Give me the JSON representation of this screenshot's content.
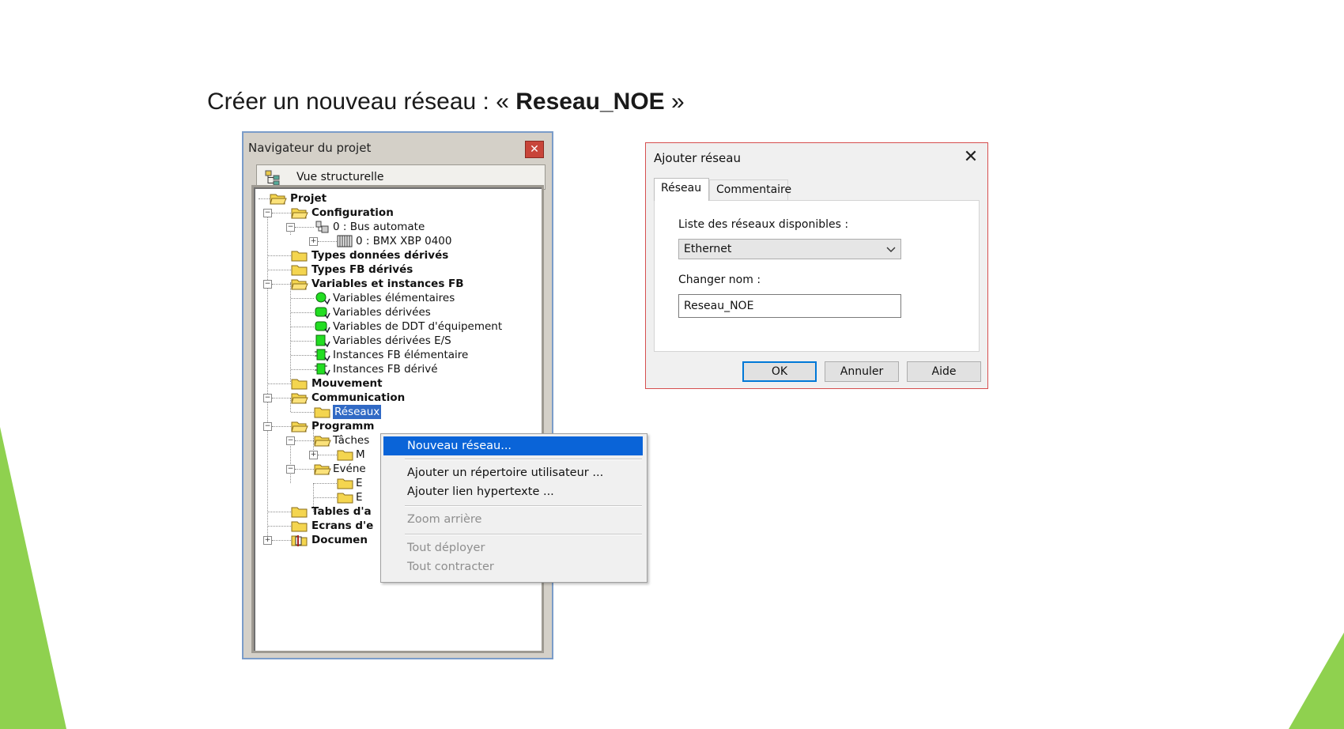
{
  "slide": {
    "title_prefix": "Créer un nouveau réseau : «",
    "title_bold": "Reseau_NOE",
    "title_suffix": "»"
  },
  "navigator": {
    "title": "Navigateur du projet",
    "close_icon": "close-icon",
    "view_label": "Vue structurelle",
    "tree": {
      "projet": "Projet",
      "configuration": "Configuration",
      "bus_automate": "0 : Bus automate",
      "bmx_xbp": "0 : BMX XBP 0400",
      "types_donnees": "Types données dérivés",
      "types_fb": "Types FB dérivés",
      "variables_instances": "Variables et instances FB",
      "var_elementaires": "Variables élémentaires",
      "var_derivees": "Variables dérivées",
      "var_ddt": "Variables de DDT d'équipement",
      "var_derivees_es": "Variables dérivées E/S",
      "inst_fb_elem": "Instances FB élémentaire",
      "inst_fb_derive": "Instances FB dérivé",
      "mouvement": "Mouvement",
      "communication": "Communication",
      "reseaux": "Réseaux",
      "programme": "Programm",
      "taches": "Tâches",
      "m_item": "M",
      "evenements": "Evéne",
      "e_item1": "E",
      "e_item2": "E",
      "tables": "Tables d'a",
      "ecrans": "Ecrans d'e",
      "documentation": "Documen"
    }
  },
  "context_menu": {
    "items": [
      {
        "label": "Nouveau réseau...",
        "state": "highlighted"
      },
      {
        "label": "Ajouter un répertoire utilisateur ...",
        "state": "enabled"
      },
      {
        "label": "Ajouter lien hypertexte ...",
        "state": "enabled"
      },
      {
        "label": "Zoom arrière",
        "state": "disabled"
      },
      {
        "label": "Tout déployer",
        "state": "disabled"
      },
      {
        "label": "Tout contracter",
        "state": "disabled"
      }
    ]
  },
  "dialog": {
    "title": "Ajouter réseau",
    "tabs": [
      "Réseau",
      "Commentaire"
    ],
    "active_tab": "Réseau",
    "network_list_label": "Liste des réseaux disponibles :",
    "network_selected": "Ethernet",
    "rename_label": "Changer nom :",
    "rename_value": "Reseau_NOE",
    "ok_label": "OK",
    "cancel_label": "Annuler",
    "help_label": "Aide"
  },
  "colors": {
    "selection": "#316ac5",
    "menu_highlight": "#0a64d8",
    "accent_green": "#8fd14f",
    "dialog_border": "#d64f4f"
  }
}
